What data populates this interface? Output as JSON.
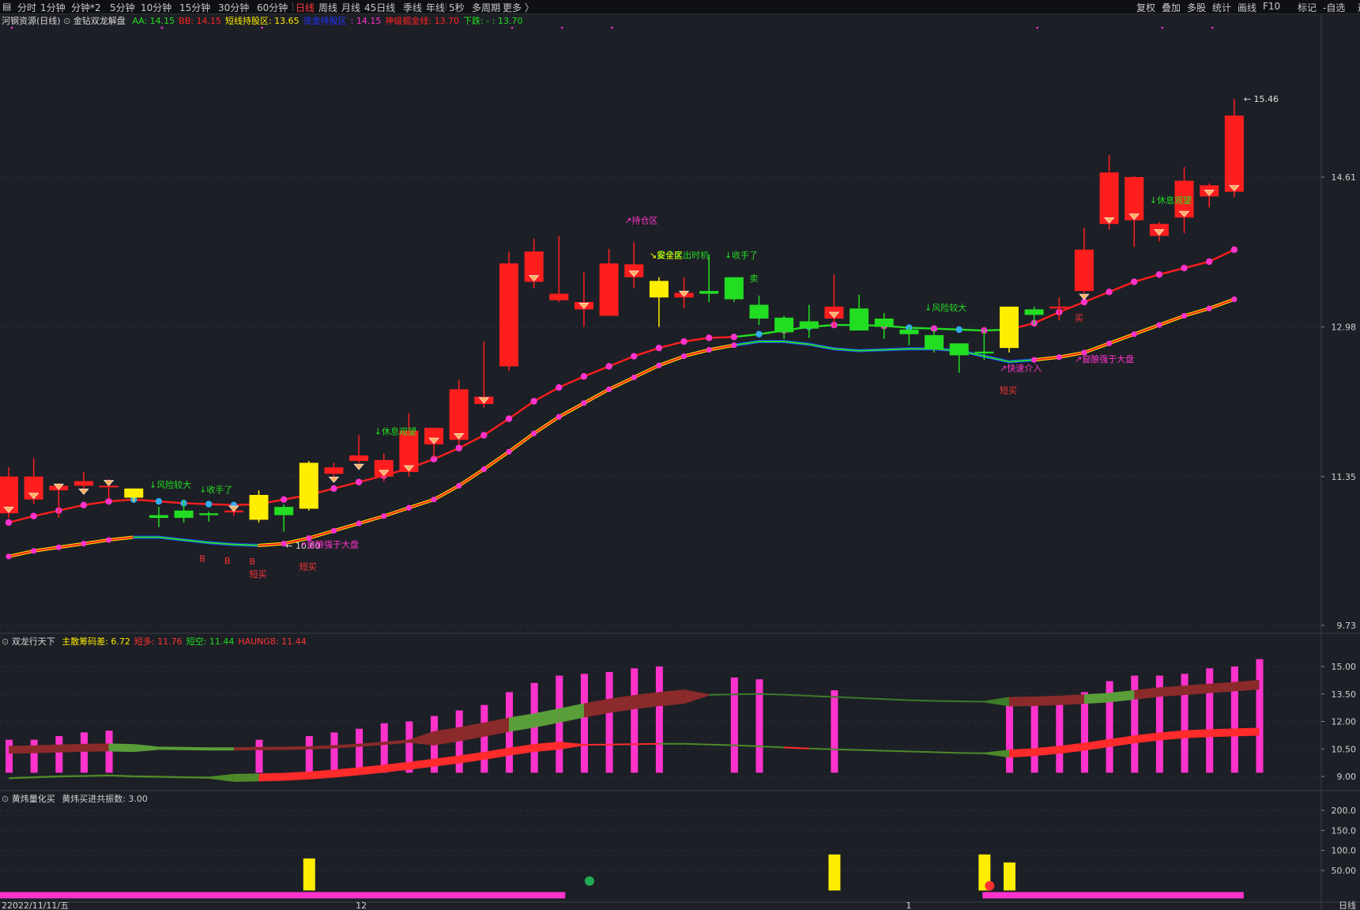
{
  "toolbar": {
    "periods": [
      "分时",
      "1分钟",
      "分钟*2",
      "5分钟",
      "10分钟",
      "15分钟",
      "30分钟",
      "60分钟",
      "日线",
      "周线",
      "月线",
      "45日线",
      "季线",
      "年线",
      "5秒",
      "多周期",
      "更多 〉"
    ],
    "active_period": "日线",
    "right_buttons": [
      "复权",
      "叠加",
      "多股",
      "统计",
      "画线",
      "F10",
      "标记",
      "-自选",
      "返回"
    ]
  },
  "main_panel": {
    "stock_name": "河钢资源(日线)",
    "indicator_name": "金钻双龙解盘",
    "params": [
      {
        "text": "AA: 14.15",
        "color": "#22dd22"
      },
      {
        "text": "BB: 14.15",
        "color": "#ff2222"
      },
      {
        "text": "短线持股区: 13.65",
        "color": "#ffee00"
      },
      {
        "text": "资金持股区",
        "color": "#2233ff"
      },
      {
        "text": ": 14.15",
        "color": "#ff33cc"
      },
      {
        "text": "神级掘金线: 13.70",
        "color": "#ff2222"
      },
      {
        "text": "下跌: - : 13.70",
        "color": "#22dd22"
      }
    ],
    "annotations": [
      {
        "text": "↓风险较大",
        "color": "#22dd22",
        "i": 6
      },
      {
        "text": "↓收手了",
        "color": "#22dd22",
        "i": 8
      },
      {
        "text": "↗窗酿强于大盘",
        "color": "#ff33cc",
        "i": 12
      },
      {
        "text": "短买",
        "color": "#ff3333",
        "i": 10
      },
      {
        "text": "短买",
        "color": "#ff3333",
        "i": 12
      },
      {
        "text": "B",
        "color": "#ff3333",
        "i": 8
      },
      {
        "text": "B",
        "color": "#ff3333",
        "i": 9
      },
      {
        "text": "B",
        "color": "#ff3333",
        "i": 10
      },
      {
        "text": "↓休息观望",
        "color": "#22dd22",
        "i": 15
      },
      {
        "text": "↗持仓区",
        "color": "#ff33cc",
        "i": 25
      },
      {
        "text": "↘最佳卖出时机",
        "color": "#22dd22",
        "i": 26
      },
      {
        "text": "↘安全区",
        "color": "#ffee00",
        "i": 26
      },
      {
        "text": "↓收手了",
        "color": "#22dd22",
        "i": 29
      },
      {
        "text": "卖",
        "color": "#22dd22",
        "i": 30
      },
      {
        "text": "↓风险较大",
        "color": "#22dd22",
        "i": 37
      },
      {
        "text": "↗快速介入",
        "color": "#ff33cc",
        "i": 40
      },
      {
        "text": "短买",
        "color": "#ff3333",
        "i": 40
      },
      {
        "text": "↗窗酿强于大盘",
        "color": "#ff33cc",
        "i": 43
      },
      {
        "text": "买",
        "color": "#ff3333",
        "i": 43
      },
      {
        "text": "↓休息观望",
        "color": "#22dd22",
        "i": 46
      }
    ],
    "marks": {
      "high": "15.46",
      "low": "10.60"
    }
  },
  "sub_panel1": {
    "name": "双龙行天下",
    "params": [
      {
        "text": "主散筹码差: 6.72",
        "color": "#ffee00"
      },
      {
        "text": "短多: 11.76",
        "color": "#ff3333"
      },
      {
        "text": "短空: 11.44",
        "color": "#22dd22"
      },
      {
        "text": "HAUNG8: 11.44",
        "color": "#ff3333"
      }
    ]
  },
  "sub_panel2": {
    "name": "黄炜量化买",
    "params": [
      {
        "text": "黄炜买进共振数: 3.00",
        "color": "#d0d0d0"
      }
    ]
  },
  "bottom_axis": {
    "date_label": "22022/11/11/五",
    "month_labels": [
      "12",
      "1"
    ],
    "corner": "日线"
  },
  "chart_data": [
    {
      "type": "candlestick",
      "title": "河钢资源(日线)",
      "ylim": [
        9.73,
        16.24
      ],
      "y_ticks": [
        9.73,
        11.35,
        12.98,
        14.61
      ],
      "candles": [
        {
          "o": 11.35,
          "h": 11.45,
          "l": 10.9,
          "c": 10.95
        },
        {
          "o": 11.35,
          "h": 11.55,
          "l": 11.05,
          "c": 11.1
        },
        {
          "o": 11.25,
          "h": 11.28,
          "l": 10.9,
          "c": 11.2
        },
        {
          "o": 11.3,
          "h": 11.4,
          "l": 11.22,
          "c": 11.25
        },
        {
          "o": 11.25,
          "h": 11.32,
          "l": 11.1,
          "c": 11.24
        },
        {
          "o": 11.12,
          "h": 11.22,
          "l": 11.08,
          "c": 11.22
        },
        {
          "o": 10.9,
          "h": 11.02,
          "l": 10.8,
          "c": 10.93
        },
        {
          "o": 10.9,
          "h": 11.1,
          "l": 10.85,
          "c": 10.98
        },
        {
          "o": 10.93,
          "h": 10.97,
          "l": 10.86,
          "c": 10.95
        },
        {
          "o": 10.98,
          "h": 11.02,
          "l": 10.92,
          "c": 10.96
        },
        {
          "o": 10.88,
          "h": 11.2,
          "l": 10.85,
          "c": 11.15
        },
        {
          "o": 10.93,
          "h": 11.05,
          "l": 10.75,
          "c": 11.02
        },
        {
          "o": 11.0,
          "h": 11.52,
          "l": 10.98,
          "c": 11.5
        },
        {
          "o": 11.45,
          "h": 11.5,
          "l": 11.35,
          "c": 11.38
        },
        {
          "o": 11.58,
          "h": 11.8,
          "l": 11.5,
          "c": 11.52
        },
        {
          "o": 11.53,
          "h": 11.6,
          "l": 11.3,
          "c": 11.35
        },
        {
          "o": 11.85,
          "h": 12.04,
          "l": 11.35,
          "c": 11.4
        },
        {
          "o": 11.88,
          "h": 11.88,
          "l": 11.55,
          "c": 11.7
        },
        {
          "o": 12.3,
          "h": 12.4,
          "l": 11.7,
          "c": 11.75
        },
        {
          "o": 12.22,
          "h": 12.82,
          "l": 12.1,
          "c": 12.14
        },
        {
          "o": 13.67,
          "h": 13.8,
          "l": 12.5,
          "c": 12.55
        },
        {
          "o": 13.8,
          "h": 13.94,
          "l": 13.4,
          "c": 13.47
        },
        {
          "o": 13.34,
          "h": 13.97,
          "l": 13.25,
          "c": 13.27
        },
        {
          "o": 13.25,
          "h": 13.57,
          "l": 12.98,
          "c": 13.17
        },
        {
          "o": 13.67,
          "h": 13.83,
          "l": 13.12,
          "c": 13.1
        },
        {
          "o": 13.66,
          "h": 13.9,
          "l": 13.4,
          "c": 13.52
        },
        {
          "o": 13.48,
          "h": 13.52,
          "l": 12.98,
          "c": 13.3
        },
        {
          "o": 13.35,
          "h": 13.52,
          "l": 13.18,
          "c": 13.3
        },
        {
          "o": 13.34,
          "h": 13.77,
          "l": 13.25,
          "c": 13.37
        },
        {
          "o": 13.52,
          "h": 13.52,
          "l": 13.25,
          "c": 13.28
        },
        {
          "o": 13.22,
          "h": 13.32,
          "l": 13.0,
          "c": 13.07
        },
        {
          "o": 12.92,
          "h": 13.1,
          "l": 12.85,
          "c": 13.08
        },
        {
          "o": 12.96,
          "h": 13.22,
          "l": 12.86,
          "c": 13.04
        },
        {
          "o": 13.2,
          "h": 13.55,
          "l": 12.98,
          "c": 13.07
        },
        {
          "o": 12.94,
          "h": 13.33,
          "l": 12.95,
          "c": 13.18
        },
        {
          "o": 12.98,
          "h": 13.13,
          "l": 12.85,
          "c": 13.07
        },
        {
          "o": 12.9,
          "h": 12.98,
          "l": 12.78,
          "c": 12.95
        },
        {
          "o": 12.74,
          "h": 12.95,
          "l": 12.7,
          "c": 12.89
        },
        {
          "o": 12.67,
          "h": 12.75,
          "l": 12.48,
          "c": 12.8
        },
        {
          "o": 12.69,
          "h": 12.95,
          "l": 12.62,
          "c": 12.71
        },
        {
          "o": 12.75,
          "h": 13.15,
          "l": 12.7,
          "c": 13.2
        },
        {
          "o": 13.11,
          "h": 13.2,
          "l": 13.0,
          "c": 13.17
        },
        {
          "o": 13.2,
          "h": 13.3,
          "l": 13.05,
          "c": 13.18
        },
        {
          "o": 13.82,
          "h": 14.06,
          "l": 13.35,
          "c": 13.37
        },
        {
          "o": 14.66,
          "h": 14.85,
          "l": 14.04,
          "c": 14.1
        },
        {
          "o": 14.61,
          "h": 14.62,
          "l": 13.85,
          "c": 14.14
        },
        {
          "o": 14.1,
          "h": 14.12,
          "l": 13.91,
          "c": 13.97
        },
        {
          "o": 14.57,
          "h": 14.72,
          "l": 14.0,
          "c": 14.17
        },
        {
          "o": 14.52,
          "h": 14.54,
          "l": 14.28,
          "c": 14.4
        },
        {
          "o": 15.28,
          "h": 15.46,
          "l": 14.39,
          "c": 14.45
        }
      ],
      "series": [
        {
          "name": "BB",
          "color": "#ff2222",
          "values": [
            10.85,
            10.92,
            10.98,
            11.04,
            11.08,
            11.1,
            11.08,
            11.06,
            11.05,
            11.04,
            11.05,
            11.1,
            11.15,
            11.22,
            11.29,
            11.36,
            11.44,
            11.54,
            11.66,
            11.8,
            11.98,
            12.17,
            12.32,
            12.44,
            12.55,
            12.66,
            12.75,
            12.82,
            12.86,
            12.87,
            12.9,
            12.94,
            12.98,
            13.0,
            13.0,
            12.99,
            12.97,
            12.96,
            12.95,
            12.94,
            12.95,
            13.02,
            13.14,
            13.25,
            13.36,
            13.47,
            13.55,
            13.62,
            13.69,
            13.82
          ]
        },
        {
          "name": "AA",
          "color": "#22dd22",
          "values": [
            10.48,
            10.54,
            10.58,
            10.62,
            10.66,
            10.69,
            10.69,
            10.66,
            10.63,
            10.61,
            10.6,
            10.62,
            10.68,
            10.76,
            10.84,
            10.92,
            11.01,
            11.1,
            11.25,
            11.43,
            11.62,
            11.82,
            12.0,
            12.15,
            12.3,
            12.43,
            12.56,
            12.66,
            12.73,
            12.78,
            12.82,
            12.82,
            12.79,
            12.74,
            12.72,
            12.73,
            12.74,
            12.74,
            12.72,
            12.66,
            12.6,
            12.62,
            12.65,
            12.7,
            12.8,
            12.9,
            13.0,
            13.1,
            13.18,
            13.28
          ]
        }
      ]
    },
    {
      "type": "bar",
      "title": "双龙行天下",
      "ylim": [
        8.6,
        16.4
      ],
      "y_ticks": [
        9.0,
        10.5,
        12.0,
        13.5,
        15.0
      ],
      "bar_values": [
        11.0,
        11.0,
        11.2,
        11.4,
        11.5,
        null,
        null,
        null,
        null,
        null,
        11.0,
        null,
        11.2,
        11.4,
        11.6,
        11.9,
        12.0,
        12.3,
        12.6,
        12.9,
        13.6,
        14.1,
        14.5,
        14.6,
        14.7,
        14.9,
        15.0,
        null,
        null,
        14.4,
        14.3,
        null,
        null,
        13.7,
        null,
        null,
        null,
        null,
        null,
        null,
        12.9,
        13.0,
        13.1,
        13.6,
        14.2,
        14.5,
        14.5,
        14.6,
        14.9,
        15.0,
        15.4
      ],
      "series": [
        {
          "name": "短多",
          "values": [
            10.45,
            10.48,
            10.52,
            10.56,
            10.58,
            10.55,
            10.54,
            10.52,
            10.5,
            10.5,
            10.52,
            10.53,
            10.56,
            10.62,
            10.7,
            10.8,
            10.92,
            11.08,
            11.3,
            11.55,
            11.82,
            12.05,
            12.32,
            12.6,
            12.85,
            13.05,
            13.22,
            13.35,
            13.45,
            13.48,
            13.5,
            13.46,
            13.4,
            13.34,
            13.28,
            13.22,
            13.16,
            13.12,
            13.1,
            13.08,
            13.08,
            13.1,
            13.15,
            13.22,
            13.3,
            13.45,
            13.6,
            13.7,
            13.8,
            13.9,
            14.0
          ]
        },
        {
          "name": "短空",
          "values": [
            8.9,
            8.95,
            9.0,
            9.02,
            9.05,
            9.0,
            8.98,
            8.95,
            8.93,
            8.92,
            8.94,
            8.98,
            9.05,
            9.15,
            9.28,
            9.42,
            9.58,
            9.75,
            9.92,
            10.12,
            10.35,
            10.55,
            10.68,
            10.72,
            10.74,
            10.76,
            10.78,
            10.78,
            10.74,
            10.7,
            10.64,
            10.58,
            10.52,
            10.48,
            10.44,
            10.4,
            10.36,
            10.32,
            10.28,
            10.26,
            10.24,
            10.32,
            10.45,
            10.62,
            10.82,
            11.02,
            11.18,
            11.3,
            11.36,
            11.4,
            11.44
          ]
        }
      ]
    },
    {
      "type": "bar",
      "title": "黄炜量化买",
      "ylim": [
        0,
        230
      ],
      "y_ticks": [
        50.0,
        100.0,
        150.0,
        200.0
      ],
      "bars": [
        {
          "i": 12,
          "value": 80
        },
        {
          "i": 33,
          "value": 90
        },
        {
          "i": 39,
          "value": 90
        },
        {
          "i": 40,
          "value": 70
        }
      ]
    }
  ],
  "colors": {
    "background": "#1d1f26",
    "up": "#ff1e1e",
    "down": "#22dd22",
    "yellow": "#ffee00",
    "magenta": "#ff33cc",
    "blue": "#1f3cff",
    "grid": "#2d2f38"
  }
}
